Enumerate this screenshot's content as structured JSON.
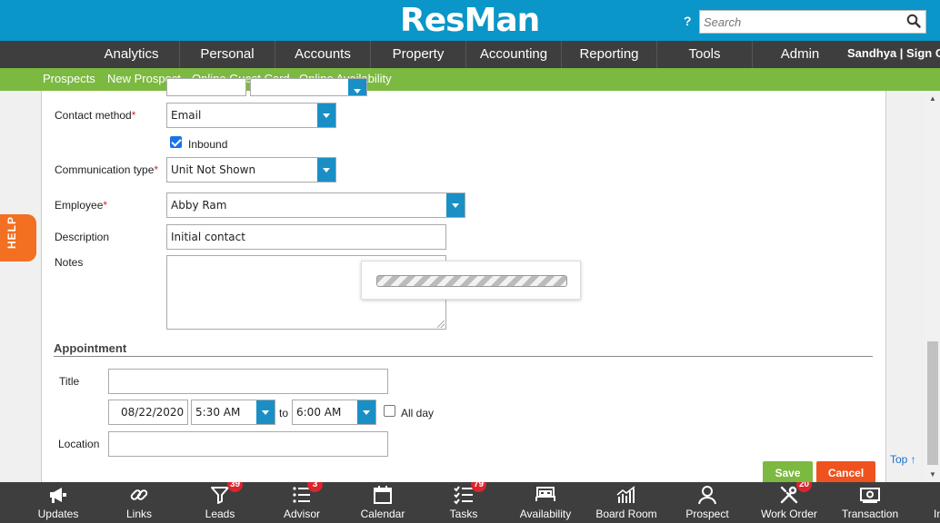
{
  "header": {
    "logo": "ResMan",
    "help": "?",
    "search_placeholder": "Search"
  },
  "mainnav": {
    "items": [
      "Analytics",
      "Personal",
      "Accounts",
      "Property",
      "Accounting",
      "Reporting",
      "Tools",
      "Admin"
    ],
    "user": "Sandhya | Sign Out"
  },
  "subnav": {
    "items": [
      "Prospects",
      "New Prospect",
      "Online Guest Card",
      "Online Availability"
    ]
  },
  "form": {
    "contact_method_label": "Contact method",
    "contact_method_value": "Email",
    "inbound_label": "Inbound",
    "inbound_checked": true,
    "communication_type_label": "Communication type",
    "communication_type_value": "Unit Not Shown",
    "employee_label": "Employee",
    "employee_value": "Abby Ram",
    "description_label": "Description",
    "description_value": "Initial contact",
    "notes_label": "Notes",
    "required_mark": "*"
  },
  "appointment": {
    "section_title": "Appointment",
    "title_label": "Title",
    "date": "08/22/2020",
    "start_time": "5:30 AM",
    "to_label": "to",
    "end_time": "6:00 AM",
    "all_day_label": "All day",
    "location_label": "Location"
  },
  "help_tab": "HELP",
  "top_link": "Top ↑",
  "actions": {
    "save": "Save",
    "cancel": "Cancel"
  },
  "toolbar": {
    "items": [
      {
        "label": "Updates",
        "icon": "megaphone-icon"
      },
      {
        "label": "Links",
        "icon": "link-icon"
      },
      {
        "label": "Leads",
        "icon": "funnel-icon",
        "badge": "39"
      },
      {
        "label": "Advisor",
        "icon": "list-icon",
        "badge": "3"
      },
      {
        "label": "Calendar",
        "icon": "calendar-icon"
      },
      {
        "label": "Tasks",
        "icon": "checklist-icon",
        "badge": "79"
      },
      {
        "label": "Availability",
        "icon": "bed-icon"
      },
      {
        "label": "Board Room",
        "icon": "bar-chart-icon"
      },
      {
        "label": "Prospect",
        "icon": "person-icon"
      },
      {
        "label": "Work Order",
        "icon": "wrench-icon",
        "badge": "20"
      },
      {
        "label": "Transaction",
        "icon": "money-icon"
      },
      {
        "label": "In",
        "icon": "inbox-icon"
      }
    ]
  },
  "colors": {
    "header": "#0a96c8",
    "nav": "#3e3e3e",
    "subnav": "#7cb940",
    "save": "#7cb940",
    "cancel": "#f0521f",
    "help": "#f36f21",
    "badge": "#d9262c"
  }
}
